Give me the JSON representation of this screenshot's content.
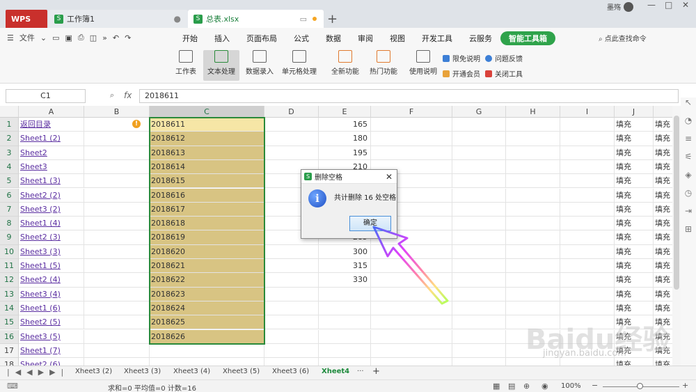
{
  "titlebar": {
    "wps_tab": "WPS",
    "inactive_tab": "工作簿1",
    "active_tab": "总表.xlsx",
    "new_tab_glyph": "+",
    "user_name": "墨殇"
  },
  "menu": {
    "file_label": "文件",
    "tabs": [
      "开始",
      "插入",
      "页面布局",
      "公式",
      "数据",
      "审阅",
      "视图",
      "开发工具",
      "云服务",
      "智能工具箱"
    ],
    "active_tab": "智能工具箱",
    "search_cmd": "点此查找命令"
  },
  "ribbon": {
    "buttons": [
      "工作表",
      "文本处理",
      "数据录入",
      "单元格处理",
      "全新功能",
      "热门功能",
      "使用说明"
    ],
    "selected": "文本处理",
    "small": [
      "限免说明",
      "问题反馈",
      "开通会员",
      "关闭工具"
    ]
  },
  "formula": {
    "name_box": "C1",
    "fx": "fx",
    "value": "2018611"
  },
  "grid": {
    "columns": [
      "A",
      "B",
      "C",
      "D",
      "E",
      "F",
      "G",
      "H",
      "I",
      "J"
    ],
    "rows": [
      "1",
      "2",
      "3",
      "4",
      "5",
      "6",
      "7",
      "8",
      "9",
      "10",
      "11",
      "12",
      "13",
      "14",
      "15",
      "16",
      "17",
      "18"
    ],
    "col_a": [
      "返回目录",
      "Sheet1 (2)",
      "Sheet2",
      "Sheet3",
      "Sheet1 (3)",
      "Sheet2 (2)",
      "Sheet3 (2)",
      "Sheet1 (4)",
      "Sheet2 (3)",
      "Sheet3 (3)",
      "Sheet1 (5)",
      "Sheet2 (4)",
      "Sheet3 (4)",
      "Sheet1 (6)",
      "Sheet2 (5)",
      "Sheet3 (5)",
      "Sheet1 (7)",
      "Sheet2 (6)"
    ],
    "col_c": [
      "2018611",
      "2018612",
      "2018613",
      "2018614",
      "2018615",
      "2018616",
      "2018617",
      "2018618",
      "2018619",
      "2018620",
      "2018621",
      "2018622",
      "2018623",
      "2018624",
      "2018625",
      "2018626"
    ],
    "col_e": [
      "165",
      "180",
      "195",
      "210",
      "",
      "",
      "",
      "",
      "285",
      "300",
      "315",
      "330"
    ],
    "fill_text": "填充"
  },
  "sheets": {
    "tabs": [
      "Xheet3 (2)",
      "Xheet3 (3)",
      "Xheet3 (4)",
      "Xheet3 (5)",
      "Xheet3 (6)",
      "Xheet4"
    ],
    "active": "Xheet4",
    "more": "···",
    "add": "+"
  },
  "status": {
    "summary": "求和=0  平均值=0  计数=16",
    "zoom": "100%"
  },
  "dialog": {
    "title": "删除空格",
    "message": "共计删除 16 处空格",
    "ok_label": "确定",
    "info_glyph": "i",
    "close_glyph": "✕"
  },
  "watermark": {
    "text": "Baidu经验",
    "sub": "jingyan.baidu.com"
  }
}
